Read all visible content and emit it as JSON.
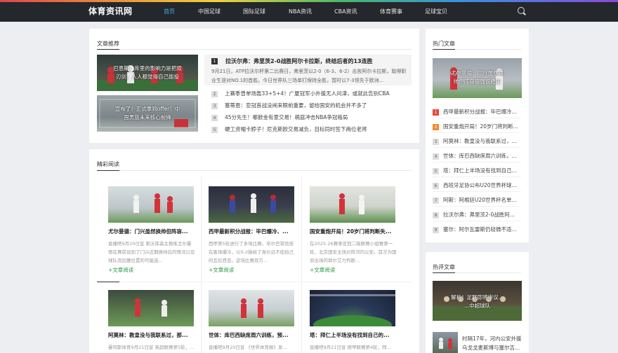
{
  "brand": {
    "logo": "体育资讯网"
  },
  "nav": [
    {
      "label": "首页",
      "active": true
    },
    {
      "label": "中国足球"
    },
    {
      "label": "国际足球"
    },
    {
      "label": "NBA资讯"
    },
    {
      "label": "CBA资讯"
    },
    {
      "label": "体育赛事"
    },
    {
      "label": "足球宝贝"
    }
  ],
  "recommend": {
    "title": "文章推荐",
    "image_cards": [
      {
        "caption_line1": "巴恩斯：库里的影响力是把双",
        "caption_line2": "刃剑，人人都觉得自己能投"
      },
      {
        "caption_line1": "宣布了！正式拿到offer！中",
        "caption_line2": "国男篮未来核心前锋"
      }
    ],
    "headline": {
      "num": "1",
      "title": "拉沃尔弗：弗里茨2-0战胜阿尔卡拉斯，终结后者的13连胜",
      "desc": "9月21日，ATP拉沃尔杯第二比赛日，弗里茨以2-0（6-3、6-2）击败阿尔卡拉斯，取得职业生涯对NO.1的首胜。今日世界队三场单打保持全胜，暂时以7-3领先于欧洲..."
    },
    "list": [
      {
        "num": "2",
        "title": "上赛季曾单场轰33+5+4！广厦冠军小外援无人问津，或就此告别CBA"
      },
      {
        "num": "3",
        "title": "塞蒂恩：亚冠首战没闹来眼前重要，留给国安的机会并不多了"
      },
      {
        "num": "4",
        "title": "45分先生！哪掀金有意交易！萌庭冲击NBA争冠格局"
      },
      {
        "num": "5",
        "title": "硬工资帽卡脖子！尼克斯欧交易减负，目标同时签下两位老将"
      }
    ]
  },
  "featured": {
    "title": "精彩阅读",
    "read_more": "+文章阅读",
    "items": [
      {
        "title": "尤尔曼德：门兴虽然换帅但阵容...",
        "desc": "直播吧9月20日宣 勒沃库森主教练尤尔曼德在赛前谈到了门兴近期换帅后的情况以及球队双后腰位置的可能选..."
      },
      {
        "title": "西甲最新积分战报：毕巴爆冷、...",
        "desc": "西甲第5轮进行了多场比赛。毕尔巴鄂竞技在客场爆冷，以0-2输给了身价远不如自己的瓦伦西亚。这场比赛双方..."
      },
      {
        "title": "国安重炮开局！20岁门将判断失...",
        "desc": "在2025-26赛季亚冠二级联赛小组赛第一轮，北京国安主场对阵河内公安。首次为国安出场的郭尔艾力判断..."
      },
      {
        "title": "阿莫林：教皇没与我联系过，那...",
        "desc": "曼彻斯体育9月21日宣 英超联赛第5轮，..."
      },
      {
        "title": "世体：库巴西缺席周六训练，预...",
        "desc": "直播吧9月20日宣 《世界体育报》发..."
      },
      {
        "title": "塔：拜仁上半场没有找到自己的...",
        "desc": "直播吧9月21日宣 德甲联赛第4轮，拜..."
      }
    ]
  },
  "hot": {
    "title": "热门文章",
    "image_caption_line1": "尤尔曼德：门兴虽然换",
    "image_caption_line2": "帅但阵容很强很稳定",
    "items": [
      {
        "num": "1",
        "title": "西甲最新积分战报：毕巴爆冷..."
      },
      {
        "num": "2",
        "title": "国安重炮开局！20岁门将判断..."
      },
      {
        "num": "3",
        "title": "阿莫林：教皇没与我联系过，..."
      },
      {
        "num": "4",
        "title": "世体：库巴西缺席周六训练，..."
      },
      {
        "num": "5",
        "title": "塔：拜仁上半场没有找到自己..."
      },
      {
        "num": "6",
        "title": "西班牙足协公布U20世界杯球..."
      },
      {
        "num": "7",
        "title": "阿斯：阿根廷U20世界杯名单..."
      },
      {
        "num": "8",
        "title": "拉沃尔弗：弗里茨2-0战胜阿..."
      },
      {
        "num": "9",
        "title": "塞尔：阿尔瓦雷斯仍轻微不适..."
      }
    ]
  },
  "hot_comments": {
    "title": "热评文章",
    "image_caption_line1": "解析！足联即将审议...",
    "image_caption_line2": "...中超球队",
    "thumb_item": {
      "title_line1": "时隔17年，河内公安外援",
      "title_line2": "乌戈戈麦斯博与塞尔吉..."
    }
  }
}
